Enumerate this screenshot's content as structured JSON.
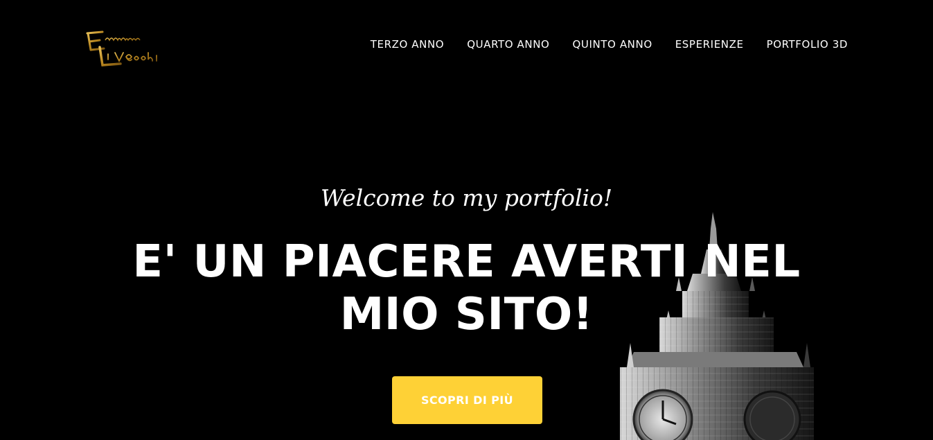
{
  "navbar": {
    "logo_alt": "Emanuele Li Vecchi",
    "items": [
      {
        "label": "TERZO ANNO"
      },
      {
        "label": "QUARTO ANNO"
      },
      {
        "label": "QUINTO ANNO"
      },
      {
        "label": "ESPERIENZE"
      },
      {
        "label": "PORTFOLIO 3D"
      }
    ]
  },
  "hero": {
    "subheading": "Welcome to my portfolio!",
    "heading": "E' UN PIACERE AVERTI NEL MIO SITO!",
    "cta_label": "SCOPRI DI PIÙ"
  },
  "colors": {
    "background": "#000000",
    "accent": "#fed136",
    "text": "#ffffff",
    "logo_gold": "#c89b2c"
  }
}
